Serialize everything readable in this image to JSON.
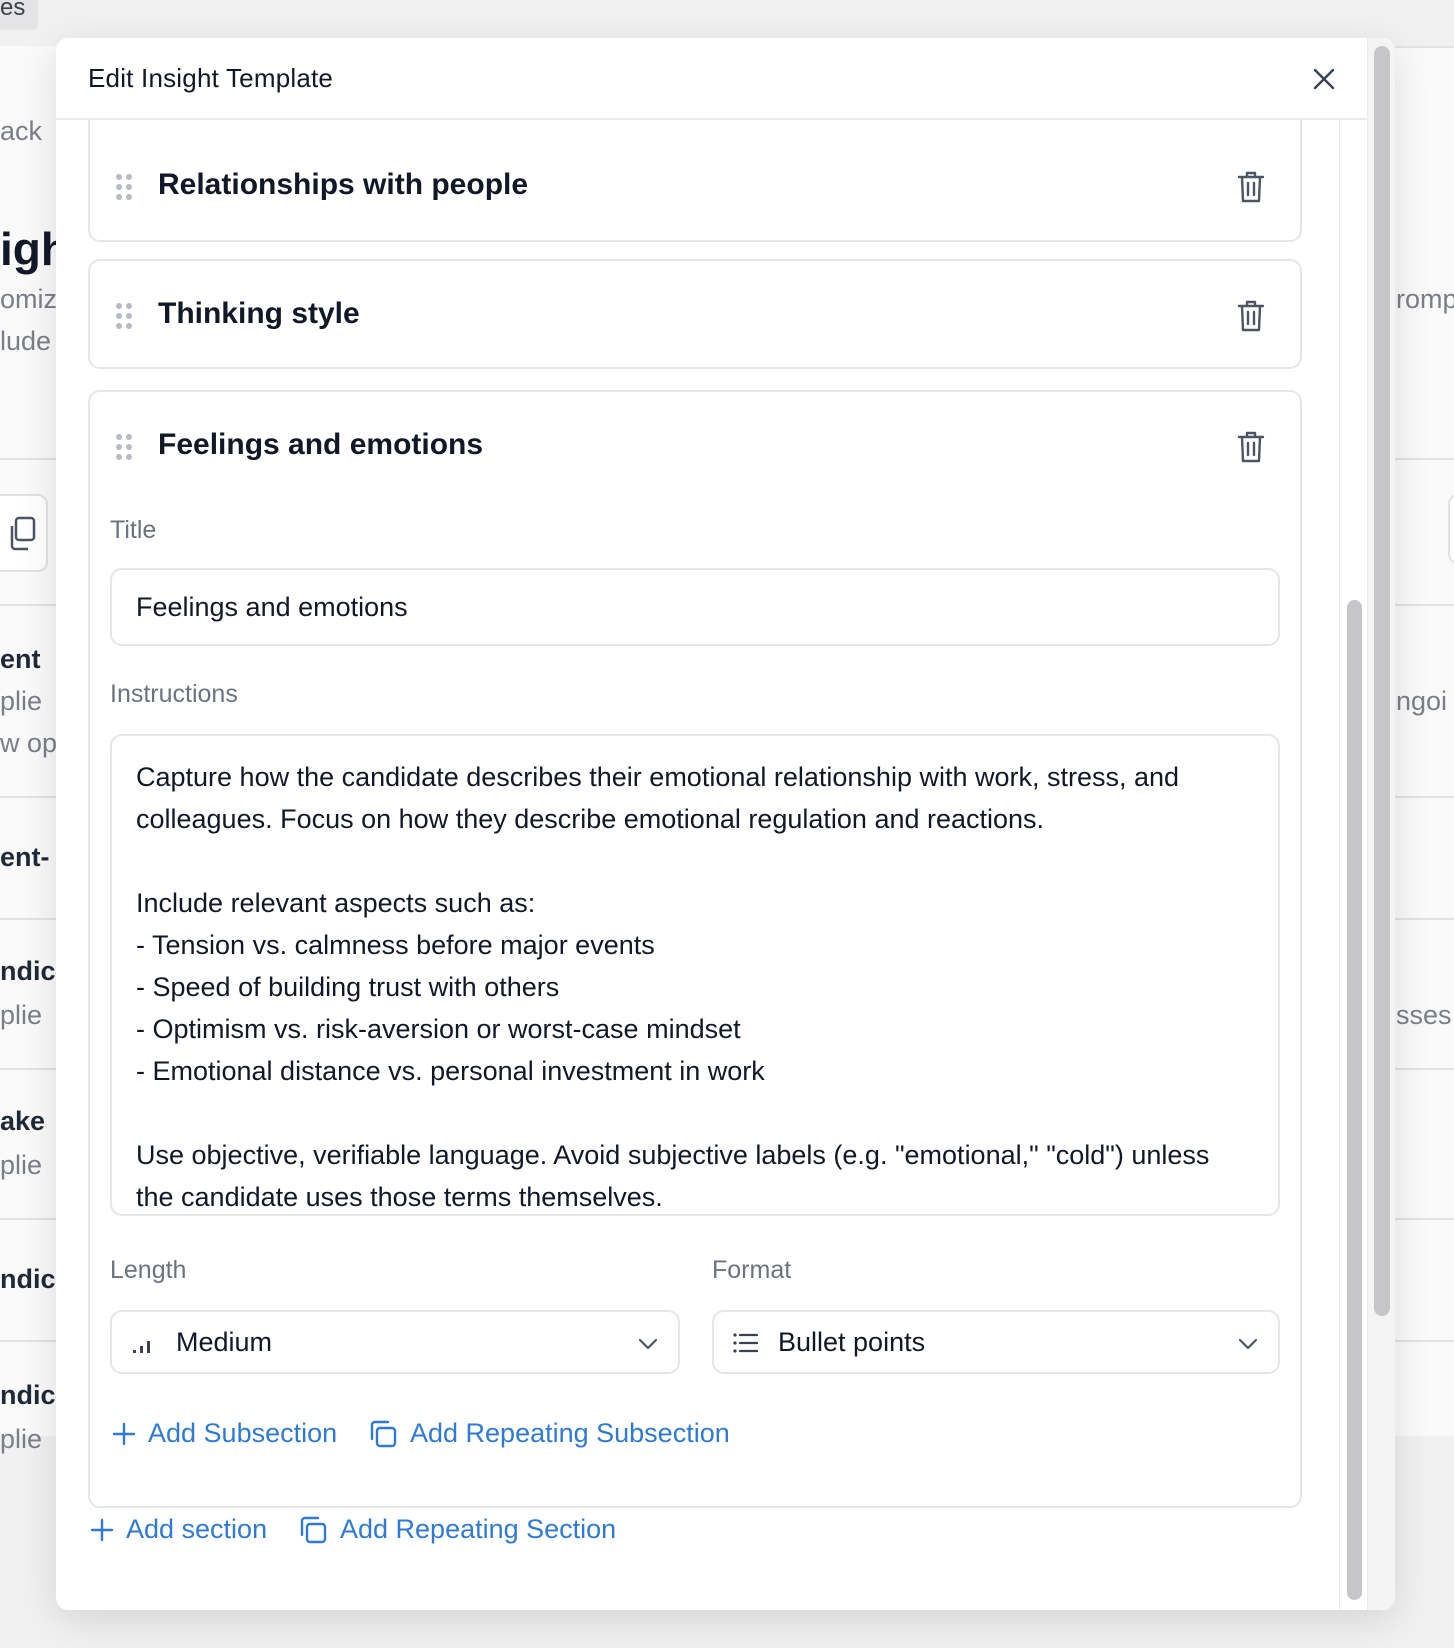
{
  "background": {
    "fragments_left": [
      "es",
      "ack",
      "igh",
      "omiz",
      "lude",
      "ent",
      "plie",
      "w op",
      "ent-",
      "ndic",
      "plie",
      "ake",
      "plie",
      "ndic",
      "ndic",
      "plie"
    ],
    "fragments_right": [
      "romp",
      "ngoi",
      "sses"
    ]
  },
  "modal": {
    "title": "Edit Insight Template",
    "close_label": "×"
  },
  "sections": [
    {
      "title": "Relationships with people"
    },
    {
      "title": "Thinking style"
    },
    {
      "title": "Feelings and emotions",
      "fields": {
        "title_label": "Title",
        "title_value": "Feelings and emotions",
        "instructions_label": "Instructions",
        "instructions_value": "Capture how the candidate describes their emotional relationship with work, stress, and colleagues. Focus on how they describe emotional regulation and reactions.\n\nInclude relevant aspects such as:\n- Tension vs. calmness before major events\n- Speed of building trust with others\n- Optimism vs. risk-aversion or worst-case mindset\n- Emotional distance vs. personal investment in work\n\nUse objective, verifiable language. Avoid subjective labels (e.g. \"emotional,\" \"cold\") unless the candidate uses those terms themselves.",
        "length_label": "Length",
        "length_value": "Medium",
        "format_label": "Format",
        "format_value": "Bullet points"
      },
      "actions": {
        "add_subsection": "Add Subsection",
        "add_repeating_subsection": "Add Repeating Subsection"
      }
    }
  ],
  "footer_actions": {
    "add_section": "Add section",
    "add_repeating_section": "Add Repeating Section"
  },
  "colors": {
    "accent": "#2f7ad8",
    "border": "#e4e6ea",
    "muted_text": "#6b7280"
  }
}
